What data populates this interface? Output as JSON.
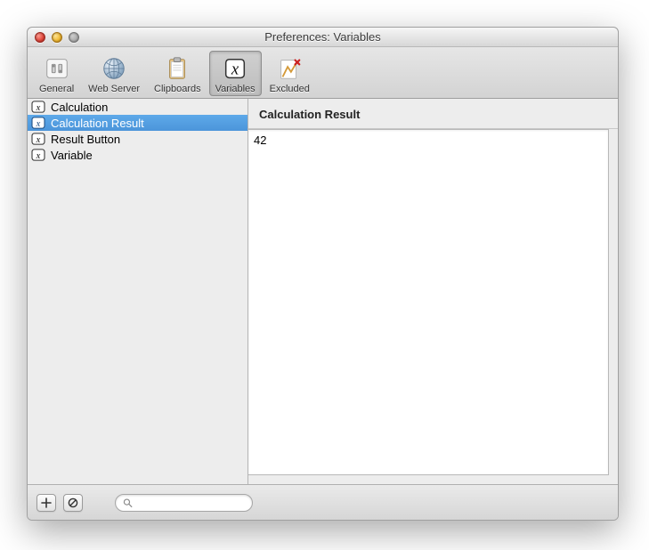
{
  "window": {
    "title": "Preferences: Variables"
  },
  "toolbar": {
    "items": [
      {
        "id": "general",
        "label": "General"
      },
      {
        "id": "webserver",
        "label": "Web Server"
      },
      {
        "id": "clipboards",
        "label": "Clipboards"
      },
      {
        "id": "variables",
        "label": "Variables"
      },
      {
        "id": "excluded",
        "label": "Excluded"
      }
    ],
    "selected_index": 3
  },
  "sidebar": {
    "variables": [
      {
        "name": "Calculation"
      },
      {
        "name": "Calculation Result"
      },
      {
        "name": "Result Button"
      },
      {
        "name": "Variable"
      }
    ],
    "selected_index": 1
  },
  "detail": {
    "title": "Calculation Result",
    "value": "42"
  },
  "bottom": {
    "search_placeholder": ""
  }
}
